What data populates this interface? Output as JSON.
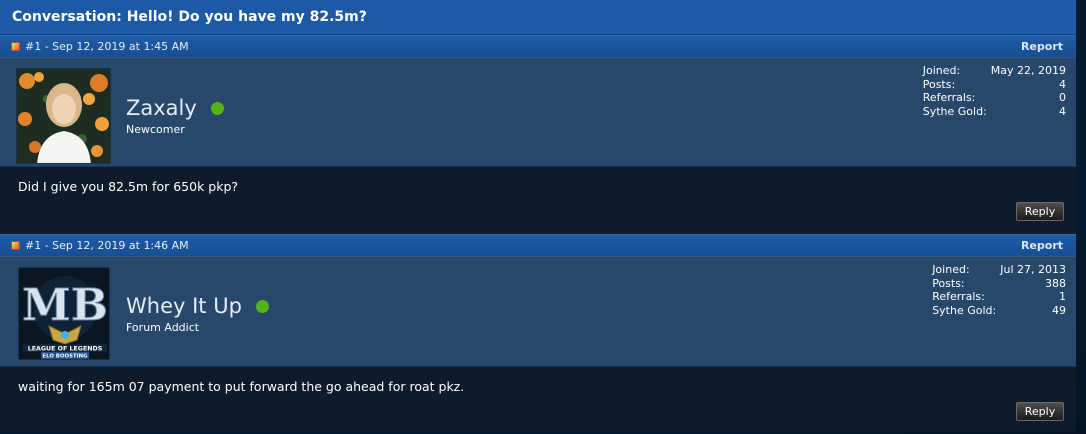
{
  "conversation": {
    "title": "Conversation: Hello! Do you have my 82.5m?"
  },
  "posts": [
    {
      "number": "#1 - Sep 12, 2019 at 1:45 AM",
      "report_label": "Report",
      "username": "Zaxaly",
      "user_title": "Newcomer",
      "stats": {
        "joined_label": "Joined:",
        "joined": "May 22, 2019",
        "posts_label": "Posts:",
        "posts": "4",
        "referrals_label": "Referrals:",
        "referrals": "0",
        "gold_label": "Sythe Gold:",
        "gold": "4"
      },
      "message": "Did I give you 82.5m for 650k pkp?",
      "reply_label": "Reply"
    },
    {
      "number": "#1 - Sep 12, 2019 at 1:46 AM",
      "report_label": "Report",
      "username": "Whey It Up",
      "user_title": "Forum Addict",
      "avatar_text": {
        "monogram": "MB",
        "line1": "LEAGUE OF LEGENDS",
        "line2": "ELO BOOSTING"
      },
      "stats": {
        "joined_label": "Joined:",
        "joined": "Jul 27, 2013",
        "posts_label": "Posts:",
        "posts": "388",
        "referrals_label": "Referrals:",
        "referrals": "1",
        "gold_label": "Sythe Gold:",
        "gold": "49"
      },
      "message": "waiting for 165m 07 payment to put forward the go ahead for roat pkz.",
      "reply_label": "Reply"
    }
  ],
  "colors": {
    "header_blue": "#1c5aa6",
    "userbar": "#27476b",
    "body_dark": "#0d1b2b",
    "online_green": "#52b415"
  },
  "icons": [
    "post-icon",
    "online-status-icon",
    "avatar-image"
  ]
}
